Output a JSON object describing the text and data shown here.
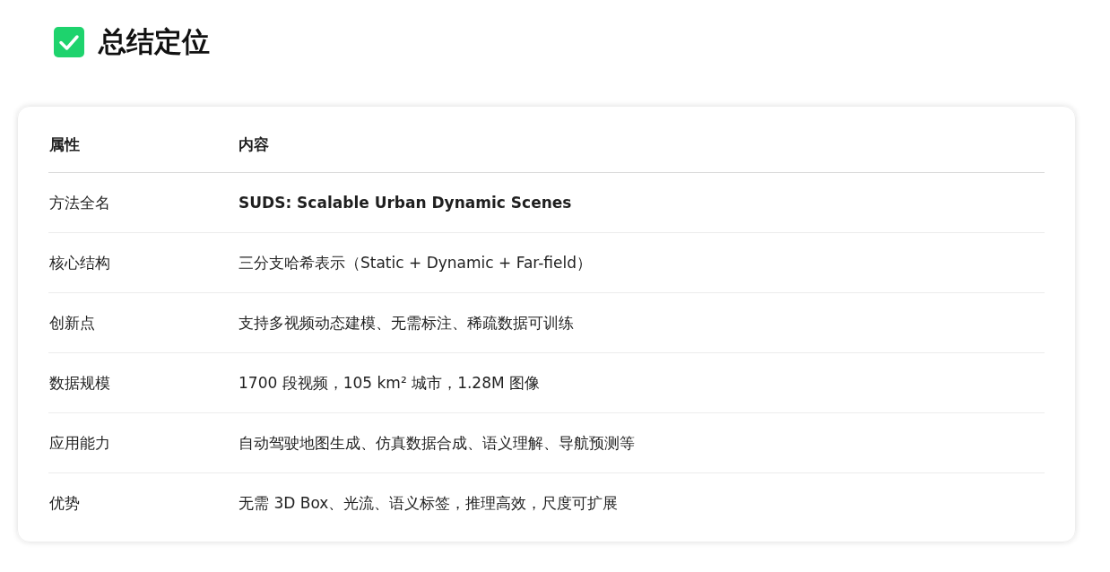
{
  "heading": {
    "title": "总结定位"
  },
  "table": {
    "columns": [
      "属性",
      "内容"
    ],
    "rows": [
      {
        "attribute": "方法全名",
        "content": "SUDS: Scalable Urban Dynamic Scenes",
        "bold": true
      },
      {
        "attribute": "核心结构",
        "content": "三分支哈希表示（Static + Dynamic + Far-field）",
        "bold": false
      },
      {
        "attribute": "创新点",
        "content": "支持多视频动态建模、无需标注、稀疏数据可训练",
        "bold": false
      },
      {
        "attribute": "数据规模",
        "content": "1700 段视频，105 km² 城市，1.28M 图像",
        "bold": false
      },
      {
        "attribute": "应用能力",
        "content": "自动驾驶地图生成、仿真数据合成、语义理解、导航预测等",
        "bold": false
      },
      {
        "attribute": "优势",
        "content": "无需 3D Box、光流、语义标签，推理高效，尺度可扩展",
        "bold": false
      }
    ]
  }
}
